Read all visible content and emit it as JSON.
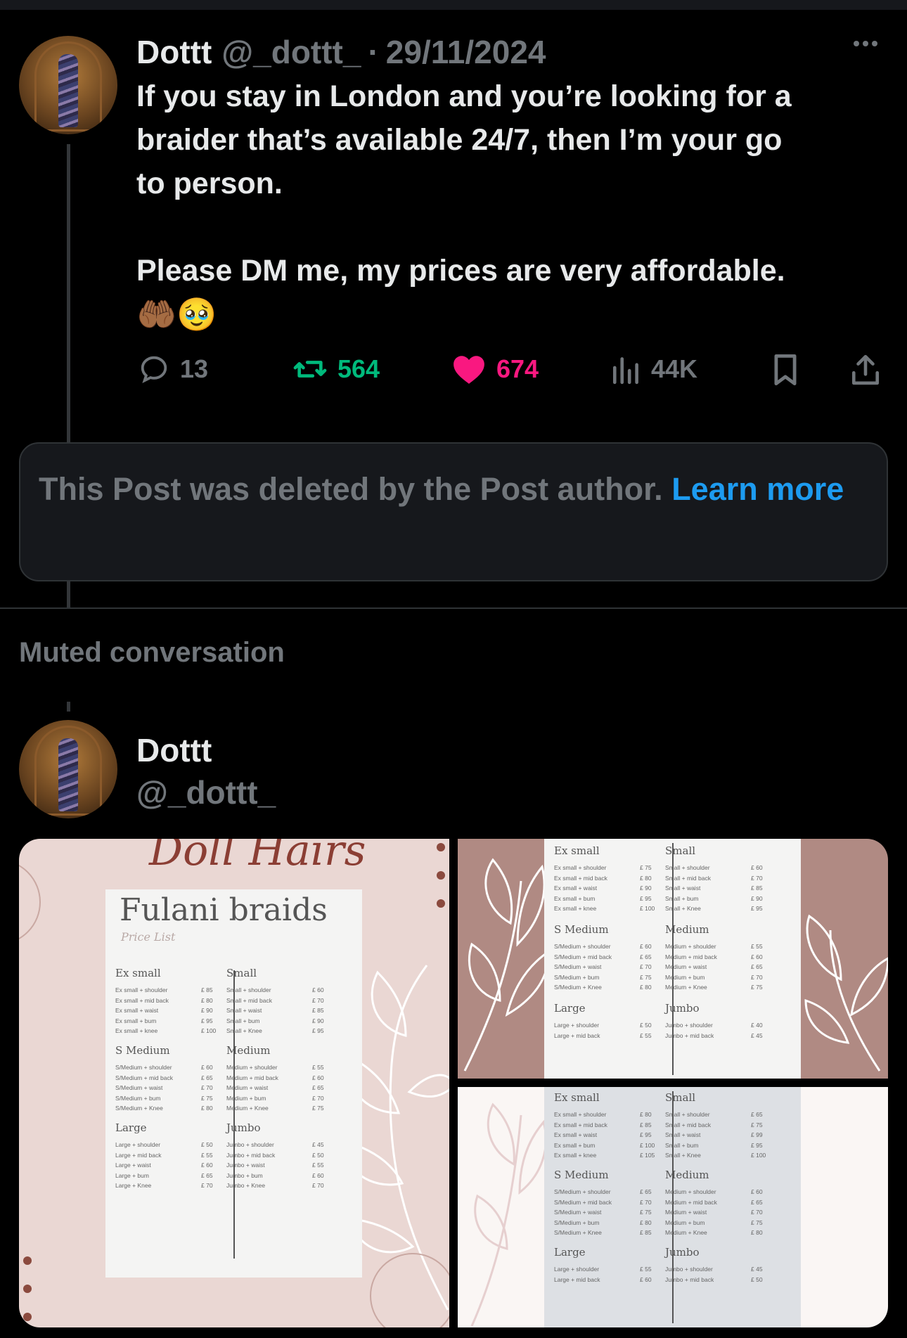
{
  "post1": {
    "name": "Dottt",
    "handle": "@_dottt_",
    "separator": "·",
    "date": "29/11/2024",
    "text": "If you stay in London and you’re looking for a\nbraider that’s available 24/7, then I’m your go\nto person.\n\nPlease DM me, my prices are very affordable.",
    "emoji": "🤲🏾🥹",
    "actions": {
      "replies": "13",
      "reposts": "564",
      "likes": "674",
      "views": "44K"
    }
  },
  "deleted_notice": {
    "text": "This Post was deleted by the Post author. ",
    "link": "Learn more"
  },
  "muted_label": "Muted conversation",
  "post2": {
    "name": "Dottt",
    "handle": "@_dottt_"
  },
  "media": {
    "left": {
      "brand": "Doll Hairs",
      "title": "Fulani braids",
      "subtitle": "Price List",
      "sections": [
        {
          "title": "Ex small",
          "rows": [
            [
              "Ex small + shoulder",
              "£ 85"
            ],
            [
              "Ex small + mid back",
              "£ 80"
            ],
            [
              "Ex small + waist",
              "£ 90"
            ],
            [
              "Ex small + bum",
              "£ 95"
            ],
            [
              "Ex small + knee",
              "£ 100"
            ]
          ]
        },
        {
          "title": "Small",
          "rows": [
            [
              "Small + shoulder",
              "£ 60"
            ],
            [
              "Small + mid back",
              "£ 70"
            ],
            [
              "Small + waist",
              "£ 85"
            ],
            [
              "Small + bum",
              "£ 90"
            ],
            [
              "Small + Knee",
              "£ 95"
            ]
          ]
        },
        {
          "title": "S Medium",
          "rows": [
            [
              "S/Medium + shoulder",
              "£ 60"
            ],
            [
              "S/Medium + mid back",
              "£ 65"
            ],
            [
              "S/Medium + waist",
              "£ 70"
            ],
            [
              "S/Medium + bum",
              "£ 75"
            ],
            [
              "S/Medium + Knee",
              "£ 80"
            ]
          ]
        },
        {
          "title": "Medium",
          "rows": [
            [
              "Medium + shoulder",
              "£ 55"
            ],
            [
              "Medium + mid back",
              "£ 60"
            ],
            [
              "Medium + waist",
              "£ 65"
            ],
            [
              "Medium + bum",
              "£ 70"
            ],
            [
              "Medium + Knee",
              "£ 75"
            ]
          ]
        },
        {
          "title": "Large",
          "rows": [
            [
              "Large + shoulder",
              "£ 50"
            ],
            [
              "Large + mid back",
              "£ 55"
            ],
            [
              "Large + waist",
              "£ 60"
            ],
            [
              "Large + bum",
              "£ 65"
            ],
            [
              "Large + Knee",
              "£ 70"
            ]
          ]
        },
        {
          "title": "Jumbo",
          "rows": [
            [
              "Jumbo + shoulder",
              "£ 45"
            ],
            [
              "Jumbo + mid back",
              "£ 50"
            ],
            [
              "Jumbo + waist",
              "£ 55"
            ],
            [
              "Jumbo + bum",
              "£ 60"
            ],
            [
              "Jumbo + Knee",
              "£ 70"
            ]
          ]
        }
      ]
    },
    "top_right": {
      "sections": [
        {
          "title": "Ex small",
          "rows": [
            [
              "Ex small + shoulder",
              "£ 75"
            ],
            [
              "Ex small + mid back",
              "£ 80"
            ],
            [
              "Ex small + waist",
              "£ 90"
            ],
            [
              "Ex small + bum",
              "£ 95"
            ],
            [
              "Ex small + knee",
              "£ 100"
            ]
          ]
        },
        {
          "title": "Small",
          "rows": [
            [
              "Small + shoulder",
              "£ 60"
            ],
            [
              "Small + mid back",
              "£ 70"
            ],
            [
              "Small + waist",
              "£ 85"
            ],
            [
              "Small + bum",
              "£ 90"
            ],
            [
              "Small + Knee",
              "£ 95"
            ]
          ]
        },
        {
          "title": "S Medium",
          "rows": [
            [
              "S/Medium + shoulder",
              "£ 60"
            ],
            [
              "S/Medium + mid back",
              "£ 65"
            ],
            [
              "S/Medium + waist",
              "£ 70"
            ],
            [
              "S/Medium + bum",
              "£ 75"
            ],
            [
              "S/Medium + Knee",
              "£ 80"
            ]
          ]
        },
        {
          "title": "Medium",
          "rows": [
            [
              "Medium + shoulder",
              "£ 55"
            ],
            [
              "Medium + mid back",
              "£ 60"
            ],
            [
              "Medium + waist",
              "£ 65"
            ],
            [
              "Medium + bum",
              "£ 70"
            ],
            [
              "Medium + Knee",
              "£ 75"
            ]
          ]
        },
        {
          "title": "Large",
          "rows": [
            [
              "Large + shoulder",
              "£ 50"
            ],
            [
              "Large + mid back",
              "£ 55"
            ]
          ]
        },
        {
          "title": "Jumbo",
          "rows": [
            [
              "Jumbo + shoulder",
              "£ 40"
            ],
            [
              "Jumbo + mid back",
              "£ 45"
            ]
          ]
        }
      ]
    },
    "bottom_right": {
      "sections": [
        {
          "title": "Ex small",
          "rows": [
            [
              "Ex small + shoulder",
              "£ 80"
            ],
            [
              "Ex small + mid back",
              "£ 85"
            ],
            [
              "Ex small + waist",
              "£ 95"
            ],
            [
              "Ex small + bum",
              "£ 100"
            ],
            [
              "Ex small + knee",
              "£ 105"
            ]
          ]
        },
        {
          "title": "Small",
          "rows": [
            [
              "Small + shoulder",
              "£ 65"
            ],
            [
              "Small + mid back",
              "£ 75"
            ],
            [
              "Small + waist",
              "£ 99"
            ],
            [
              "Small + bum",
              "£ 95"
            ],
            [
              "Small + Knee",
              "£ 100"
            ]
          ]
        },
        {
          "title": "S Medium",
          "rows": [
            [
              "S/Medium + shoulder",
              "£ 65"
            ],
            [
              "S/Medium + mid back",
              "£ 70"
            ],
            [
              "S/Medium + waist",
              "£ 75"
            ],
            [
              "S/Medium + bum",
              "£ 80"
            ],
            [
              "S/Medium + Knee",
              "£ 85"
            ]
          ]
        },
        {
          "title": "Medium",
          "rows": [
            [
              "Medium + shoulder",
              "£ 60"
            ],
            [
              "Medium + mid back",
              "£ 65"
            ],
            [
              "Medium + waist",
              "£ 70"
            ],
            [
              "Medium + bum",
              "£ 75"
            ],
            [
              "Medium + Knee",
              "£ 80"
            ]
          ]
        },
        {
          "title": "Large",
          "rows": [
            [
              "Large + shoulder",
              "£ 55"
            ],
            [
              "Large + mid back",
              "£ 60"
            ]
          ]
        },
        {
          "title": "Jumbo",
          "rows": [
            [
              "Jumbo + shoulder",
              "£ 45"
            ],
            [
              "Jumbo + mid back",
              "£ 50"
            ]
          ]
        }
      ]
    }
  },
  "colors": {
    "background": "#000000",
    "text": "#e7e9ea",
    "muted": "#71767b",
    "link": "#1d9bf0",
    "repost": "#00ba7c",
    "like": "#f91880"
  }
}
